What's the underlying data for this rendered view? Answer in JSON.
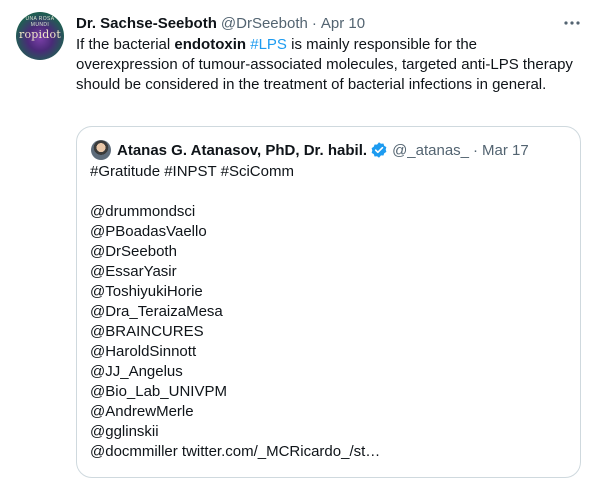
{
  "tweet": {
    "avatar_text": "ropidot",
    "avatar_ring_text": "UNA ROSA MUNDI",
    "author_name": "Dr. Sachse-Seeboth",
    "author_handle": "@DrSeeboth",
    "separator": "·",
    "date": "Apr 10",
    "more_icon": "more-horizontal-icon",
    "text_parts": [
      {
        "text": "If the bacterial ",
        "style": "normal"
      },
      {
        "text": "endotoxin",
        "style": "bold"
      },
      {
        "text": " ",
        "style": "normal"
      },
      {
        "text": "#LPS",
        "style": "hashtag"
      },
      {
        "text": " is mainly responsible for the overexpression of tumour-associated molecules, targeted anti-LPS therapy should be considered in the treatment of bacterial infections in general.",
        "style": "normal"
      }
    ]
  },
  "quote": {
    "author_name": "Atanas G. Atanasov, PhD, Dr. habil.",
    "verified_icon": "verified-badge-icon",
    "author_handle": "@_atanas_",
    "separator": "·",
    "date": "Mar 17",
    "lines": [
      "#Gratitude #INPST #SciComm",
      "",
      "@drummondsci",
      "@PBoadasVaello",
      "@DrSeeboth",
      "@EssarYasir",
      "@ToshiyukiHorie",
      "@Dra_TeraizaMesa",
      "@BRAINCURES",
      "@HaroldSinnott",
      "@JJ_Angelus",
      "@Bio_Lab_UNIVPM",
      "@AndrewMerle",
      "@gglinskii",
      "@docmmiller twitter.com/_MCRicardo_/st…"
    ]
  },
  "colors": {
    "text": "#0f1419",
    "secondary": "#536471",
    "accent": "#1d9bf0",
    "border": "#cfd9de"
  }
}
